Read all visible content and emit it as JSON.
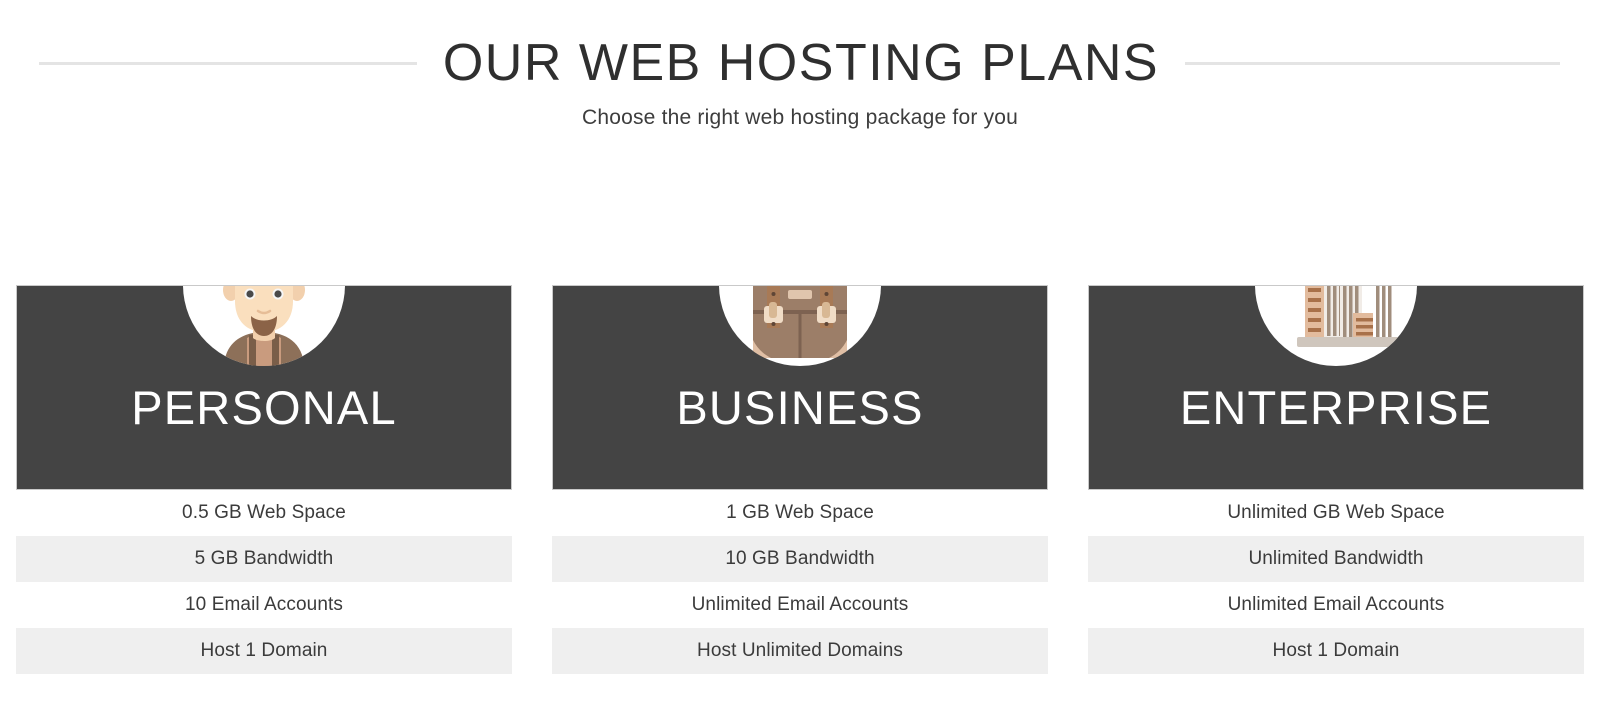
{
  "header": {
    "title": "OUR WEB HOSTING PLANS",
    "subtitle": "Choose the right web hosting package for you",
    "rule_color": "#e4e4e4"
  },
  "theme": {
    "header_bg": "#444444",
    "header_text": "#ffffff",
    "page_bg": "#ffffff",
    "row_alt_bg": "#efefef",
    "body_text": "#3b3b3b",
    "title_text": "#2f2f2f"
  },
  "plans": [
    {
      "name": "PERSONAL",
      "icon": "person-avatar-icon",
      "features": [
        "0.5 GB Web Space",
        "5 GB Bandwidth",
        "10 Email Accounts",
        "Host 1 Domain"
      ]
    },
    {
      "name": "BUSINESS",
      "icon": "briefcase-icon",
      "features": [
        "1 GB Web Space",
        "10 GB Bandwidth",
        "Unlimited Email Accounts",
        "Host Unlimited Domains"
      ]
    },
    {
      "name": "ENTERPRISE",
      "icon": "city-skyline-icon",
      "features": [
        "Unlimited GB Web Space",
        "Unlimited Bandwidth",
        "Unlimited Email Accounts",
        "Host 1 Domain"
      ]
    }
  ]
}
